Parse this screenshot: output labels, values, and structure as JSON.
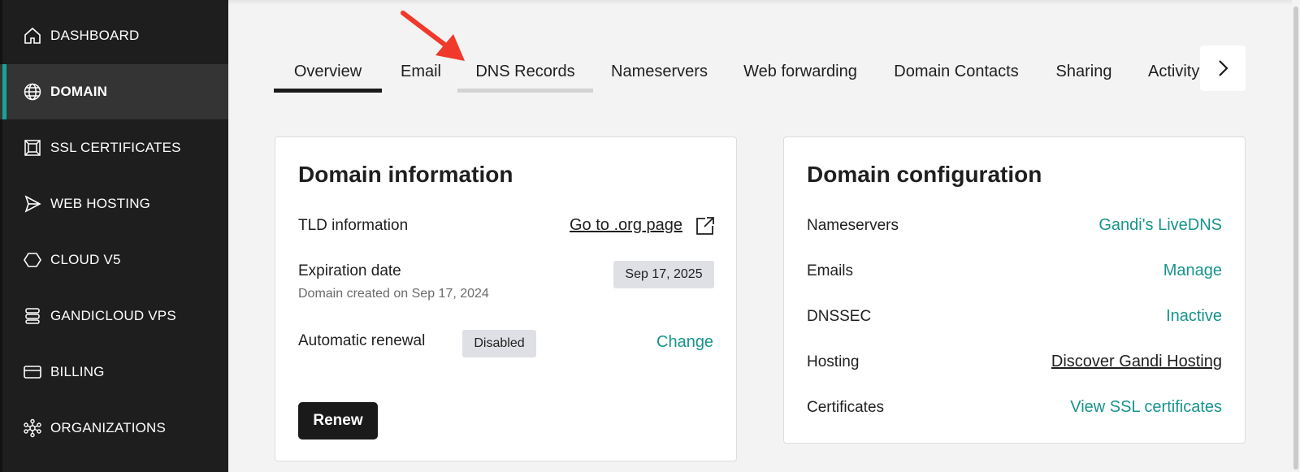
{
  "sidebar": {
    "items": [
      {
        "label": "DASHBOARD",
        "icon": "home-icon",
        "active": false
      },
      {
        "label": "DOMAIN",
        "icon": "globe-icon",
        "active": true
      },
      {
        "label": "SSL CERTIFICATES",
        "icon": "certificate-icon",
        "active": false
      },
      {
        "label": "WEB HOSTING",
        "icon": "send-icon",
        "active": false
      },
      {
        "label": "CLOUD V5",
        "icon": "hexagon-icon",
        "active": false
      },
      {
        "label": "GANDICLOUD VPS",
        "icon": "server-stack-icon",
        "active": false
      },
      {
        "label": "BILLING",
        "icon": "credit-card-icon",
        "active": false
      },
      {
        "label": "ORGANIZATIONS",
        "icon": "network-icon",
        "active": false
      }
    ],
    "accent_color": "#17a398"
  },
  "tabs": {
    "items": [
      "Overview",
      "Email",
      "DNS Records",
      "Nameservers",
      "Web forwarding",
      "Domain Contacts",
      "Sharing",
      "Activity"
    ],
    "active": "Overview",
    "hovered": "DNS Records"
  },
  "domain_information": {
    "title": "Domain information",
    "tld_label": "TLD information",
    "tld_link": "Go to .org page",
    "expiration_label": "Expiration date",
    "expiration_value": "Sep 17, 2025",
    "created_text": "Domain created on Sep 17, 2024",
    "renewal_label": "Automatic renewal",
    "renewal_status": "Disabled",
    "renewal_change": "Change",
    "renew_button": "Renew"
  },
  "domain_configuration": {
    "title": "Domain configuration",
    "rows": [
      {
        "label": "Nameservers",
        "value": "Gandi's LiveDNS"
      },
      {
        "label": "Emails",
        "value": "Manage"
      },
      {
        "label": "DNSSEC",
        "value": "Inactive"
      },
      {
        "label": "Hosting",
        "value": "Discover Gandi Hosting"
      },
      {
        "label": "Certificates",
        "value": "View SSL certificates"
      }
    ]
  },
  "colors": {
    "link_teal": "#17948b",
    "annotation_arrow": "#f0392b"
  }
}
